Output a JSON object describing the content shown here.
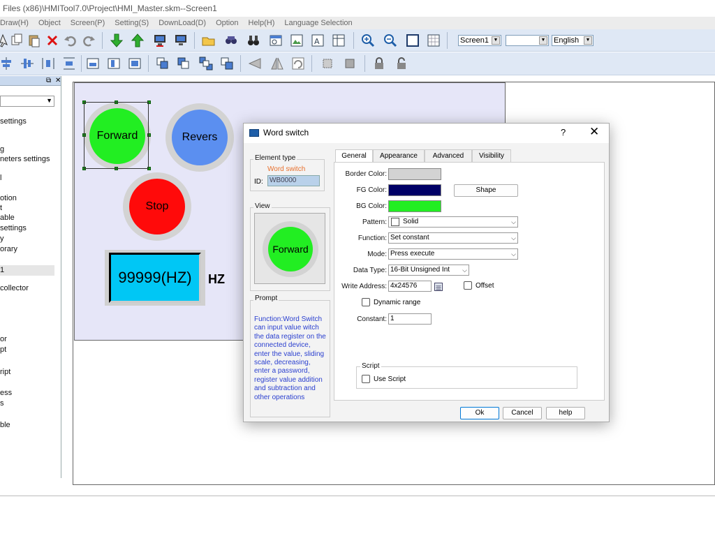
{
  "window": {
    "title": "Files (x86)\\HMITool7.0\\Project\\HMI_Master.skm--Screen1"
  },
  "menu": [
    "Draw(H)",
    "Object",
    "Screen(P)",
    "Setting(S)",
    "DownLoad(D)",
    "Option",
    "Help(H)",
    "Language Selection"
  ],
  "toolbar": {
    "screen_combo": "Screen1",
    "blank_combo": "",
    "language_combo": "English"
  },
  "left_panel": {
    "items": [
      "settings",
      "g",
      "neters settings",
      "l",
      "otion",
      "t",
      "able",
      "settings",
      "y",
      "orary",
      "1",
      "collector",
      "or",
      "pt",
      "ript",
      "ess",
      "s",
      "ble"
    ]
  },
  "canvas": {
    "buttons": {
      "forward": "Forward",
      "reverse": "Revers",
      "stop": "Stop"
    },
    "numeric_display": "99999(HZ)",
    "unit": "HZ"
  },
  "dialog": {
    "title": "Word switch",
    "help_glyph": "?",
    "close_glyph": "✕",
    "element_type": {
      "group_title": "Element type",
      "value": "Word switch",
      "id_label": "ID:",
      "id_value": "WB0000"
    },
    "view": {
      "group_title": "View",
      "preview_label": "Forward"
    },
    "prompt": {
      "group_title": "Prompt",
      "text": "Function:Word Switch can input value witch the data register on the connected device, enter the value, sliding scale, decreasing, enter a password, register value addition and subtraction and other operations"
    },
    "tabs": [
      "General",
      "Appearance",
      "Advanced",
      "Visibility"
    ],
    "general": {
      "border_color_label": "Border Color:",
      "fg_color_label": "FG Color:",
      "bg_color_label": "BG Color:",
      "shape_button": "Shape",
      "pattern_label": "Pattern:",
      "pattern_value": "Solid",
      "function_label": "Function:",
      "function_value": "Set constant",
      "mode_label": "Mode:",
      "mode_value": "Press execute",
      "data_type_label": "Data Type:",
      "data_type_value": "16-Bit Unsigned Int",
      "write_address_label": "Write Address:",
      "write_address_value": "4x24576",
      "offset_label": "Offset",
      "dynamic_range_label": "Dynamic range",
      "constant_label": "Constant:",
      "constant_value": "1",
      "script_group": "Script",
      "use_script_label": "Use Script"
    },
    "buttons": {
      "ok": "Ok",
      "cancel": "Cancel",
      "help": "help"
    }
  },
  "colors": {
    "border_color": "#d3d3d3",
    "fg_color": "#000066",
    "bg_color": "#22ee22",
    "forward": "#22ee22",
    "reverse": "#5b8ff0",
    "stop": "#ff0a0a",
    "numeric_bg": "#00c7f5",
    "element_type_text": "#e8712e",
    "prompt_text": "#2a3fcf"
  },
  "icons": [
    "pointer-icon",
    "copy-icon",
    "paste-icon",
    "delete-icon",
    "undo-icon",
    "redo-icon",
    "download-icon",
    "upload-icon",
    "simulate-offline-icon",
    "simulate-online-icon",
    "open-folder-icon",
    "library-icon",
    "binoculars-icon",
    "window-icon",
    "picture-icon",
    "font-icon",
    "table-icon",
    "zoom-in-icon",
    "zoom-out-icon",
    "fit-icon",
    "grid-icon",
    "lock-icon",
    "unlock-icon"
  ]
}
